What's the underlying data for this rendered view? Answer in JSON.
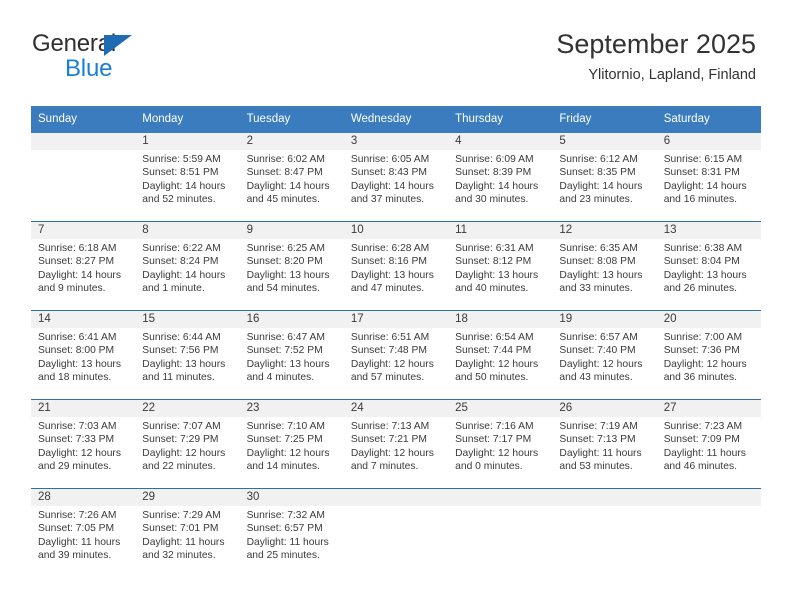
{
  "brand": {
    "name_top": "General",
    "name_bottom": "Blue",
    "triangle_color": "#1f6cb4",
    "blue_color": "#1b7fd4"
  },
  "header": {
    "title": "September 2025",
    "subtitle": "Ylitornio, Lapland, Finland",
    "header_bg": "#3a7cbe",
    "header_text_color": "#ffffff",
    "daynum_band_bg": "#f1f1f1",
    "week_divider_color": "#2f6fa8"
  },
  "weekday_headers": [
    "Sunday",
    "Monday",
    "Tuesday",
    "Wednesday",
    "Thursday",
    "Friday",
    "Saturday"
  ],
  "weeks": [
    [
      {
        "day": "",
        "empty": true,
        "sunrise": "",
        "sunset": "",
        "daylight_1": "",
        "daylight_2": ""
      },
      {
        "day": "1",
        "sunrise": "Sunrise: 5:59 AM",
        "sunset": "Sunset: 8:51 PM",
        "daylight_1": "Daylight: 14 hours",
        "daylight_2": "and 52 minutes."
      },
      {
        "day": "2",
        "sunrise": "Sunrise: 6:02 AM",
        "sunset": "Sunset: 8:47 PM",
        "daylight_1": "Daylight: 14 hours",
        "daylight_2": "and 45 minutes."
      },
      {
        "day": "3",
        "sunrise": "Sunrise: 6:05 AM",
        "sunset": "Sunset: 8:43 PM",
        "daylight_1": "Daylight: 14 hours",
        "daylight_2": "and 37 minutes."
      },
      {
        "day": "4",
        "sunrise": "Sunrise: 6:09 AM",
        "sunset": "Sunset: 8:39 PM",
        "daylight_1": "Daylight: 14 hours",
        "daylight_2": "and 30 minutes."
      },
      {
        "day": "5",
        "sunrise": "Sunrise: 6:12 AM",
        "sunset": "Sunset: 8:35 PM",
        "daylight_1": "Daylight: 14 hours",
        "daylight_2": "and 23 minutes."
      },
      {
        "day": "6",
        "sunrise": "Sunrise: 6:15 AM",
        "sunset": "Sunset: 8:31 PM",
        "daylight_1": "Daylight: 14 hours",
        "daylight_2": "and 16 minutes."
      }
    ],
    [
      {
        "day": "7",
        "sunrise": "Sunrise: 6:18 AM",
        "sunset": "Sunset: 8:27 PM",
        "daylight_1": "Daylight: 14 hours",
        "daylight_2": "and 9 minutes."
      },
      {
        "day": "8",
        "sunrise": "Sunrise: 6:22 AM",
        "sunset": "Sunset: 8:24 PM",
        "daylight_1": "Daylight: 14 hours",
        "daylight_2": "and 1 minute."
      },
      {
        "day": "9",
        "sunrise": "Sunrise: 6:25 AM",
        "sunset": "Sunset: 8:20 PM",
        "daylight_1": "Daylight: 13 hours",
        "daylight_2": "and 54 minutes."
      },
      {
        "day": "10",
        "sunrise": "Sunrise: 6:28 AM",
        "sunset": "Sunset: 8:16 PM",
        "daylight_1": "Daylight: 13 hours",
        "daylight_2": "and 47 minutes."
      },
      {
        "day": "11",
        "sunrise": "Sunrise: 6:31 AM",
        "sunset": "Sunset: 8:12 PM",
        "daylight_1": "Daylight: 13 hours",
        "daylight_2": "and 40 minutes."
      },
      {
        "day": "12",
        "sunrise": "Sunrise: 6:35 AM",
        "sunset": "Sunset: 8:08 PM",
        "daylight_1": "Daylight: 13 hours",
        "daylight_2": "and 33 minutes."
      },
      {
        "day": "13",
        "sunrise": "Sunrise: 6:38 AM",
        "sunset": "Sunset: 8:04 PM",
        "daylight_1": "Daylight: 13 hours",
        "daylight_2": "and 26 minutes."
      }
    ],
    [
      {
        "day": "14",
        "sunrise": "Sunrise: 6:41 AM",
        "sunset": "Sunset: 8:00 PM",
        "daylight_1": "Daylight: 13 hours",
        "daylight_2": "and 18 minutes."
      },
      {
        "day": "15",
        "sunrise": "Sunrise: 6:44 AM",
        "sunset": "Sunset: 7:56 PM",
        "daylight_1": "Daylight: 13 hours",
        "daylight_2": "and 11 minutes."
      },
      {
        "day": "16",
        "sunrise": "Sunrise: 6:47 AM",
        "sunset": "Sunset: 7:52 PM",
        "daylight_1": "Daylight: 13 hours",
        "daylight_2": "and 4 minutes."
      },
      {
        "day": "17",
        "sunrise": "Sunrise: 6:51 AM",
        "sunset": "Sunset: 7:48 PM",
        "daylight_1": "Daylight: 12 hours",
        "daylight_2": "and 57 minutes."
      },
      {
        "day": "18",
        "sunrise": "Sunrise: 6:54 AM",
        "sunset": "Sunset: 7:44 PM",
        "daylight_1": "Daylight: 12 hours",
        "daylight_2": "and 50 minutes."
      },
      {
        "day": "19",
        "sunrise": "Sunrise: 6:57 AM",
        "sunset": "Sunset: 7:40 PM",
        "daylight_1": "Daylight: 12 hours",
        "daylight_2": "and 43 minutes."
      },
      {
        "day": "20",
        "sunrise": "Sunrise: 7:00 AM",
        "sunset": "Sunset: 7:36 PM",
        "daylight_1": "Daylight: 12 hours",
        "daylight_2": "and 36 minutes."
      }
    ],
    [
      {
        "day": "21",
        "sunrise": "Sunrise: 7:03 AM",
        "sunset": "Sunset: 7:33 PM",
        "daylight_1": "Daylight: 12 hours",
        "daylight_2": "and 29 minutes."
      },
      {
        "day": "22",
        "sunrise": "Sunrise: 7:07 AM",
        "sunset": "Sunset: 7:29 PM",
        "daylight_1": "Daylight: 12 hours",
        "daylight_2": "and 22 minutes."
      },
      {
        "day": "23",
        "sunrise": "Sunrise: 7:10 AM",
        "sunset": "Sunset: 7:25 PM",
        "daylight_1": "Daylight: 12 hours",
        "daylight_2": "and 14 minutes."
      },
      {
        "day": "24",
        "sunrise": "Sunrise: 7:13 AM",
        "sunset": "Sunset: 7:21 PM",
        "daylight_1": "Daylight: 12 hours",
        "daylight_2": "and 7 minutes."
      },
      {
        "day": "25",
        "sunrise": "Sunrise: 7:16 AM",
        "sunset": "Sunset: 7:17 PM",
        "daylight_1": "Daylight: 12 hours",
        "daylight_2": "and 0 minutes."
      },
      {
        "day": "26",
        "sunrise": "Sunrise: 7:19 AM",
        "sunset": "Sunset: 7:13 PM",
        "daylight_1": "Daylight: 11 hours",
        "daylight_2": "and 53 minutes."
      },
      {
        "day": "27",
        "sunrise": "Sunrise: 7:23 AM",
        "sunset": "Sunset: 7:09 PM",
        "daylight_1": "Daylight: 11 hours",
        "daylight_2": "and 46 minutes."
      }
    ],
    [
      {
        "day": "28",
        "sunrise": "Sunrise: 7:26 AM",
        "sunset": "Sunset: 7:05 PM",
        "daylight_1": "Daylight: 11 hours",
        "daylight_2": "and 39 minutes."
      },
      {
        "day": "29",
        "sunrise": "Sunrise: 7:29 AM",
        "sunset": "Sunset: 7:01 PM",
        "daylight_1": "Daylight: 11 hours",
        "daylight_2": "and 32 minutes."
      },
      {
        "day": "30",
        "sunrise": "Sunrise: 7:32 AM",
        "sunset": "Sunset: 6:57 PM",
        "daylight_1": "Daylight: 11 hours",
        "daylight_2": "and 25 minutes."
      },
      {
        "day": "",
        "empty": true,
        "sunrise": "",
        "sunset": "",
        "daylight_1": "",
        "daylight_2": ""
      },
      {
        "day": "",
        "empty": true,
        "sunrise": "",
        "sunset": "",
        "daylight_1": "",
        "daylight_2": ""
      },
      {
        "day": "",
        "empty": true,
        "sunrise": "",
        "sunset": "",
        "daylight_1": "",
        "daylight_2": ""
      },
      {
        "day": "",
        "empty": true,
        "sunrise": "",
        "sunset": "",
        "daylight_1": "",
        "daylight_2": ""
      }
    ]
  ]
}
